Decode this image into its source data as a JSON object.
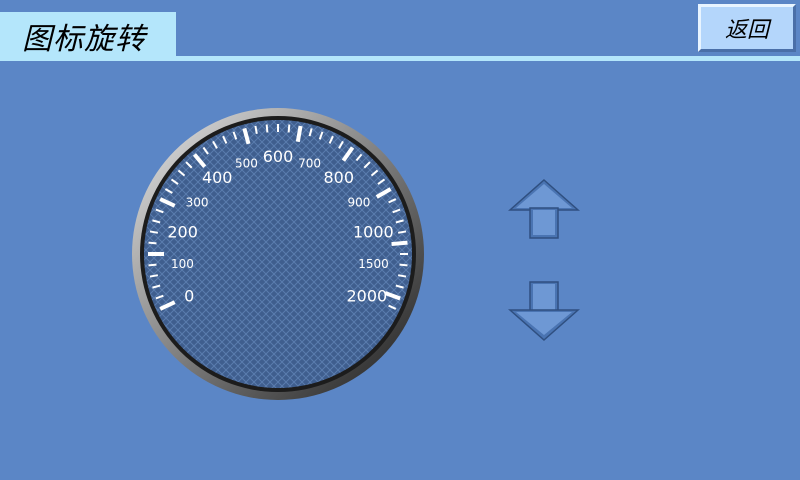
{
  "header": {
    "title": "图标旋转"
  },
  "toolbar": {
    "back_label": "返回"
  },
  "gauge": {
    "labels": [
      {
        "text": "0",
        "value": 0
      },
      {
        "text": "100",
        "value": 100
      },
      {
        "text": "200",
        "value": 200
      },
      {
        "text": "300",
        "value": 300
      },
      {
        "text": "400",
        "value": 400
      },
      {
        "text": "500",
        "value": 500
      },
      {
        "text": "600",
        "value": 600
      },
      {
        "text": "700",
        "value": 700
      },
      {
        "text": "800",
        "value": 800
      },
      {
        "text": "900",
        "value": 900
      },
      {
        "text": "1000",
        "value": 1000
      },
      {
        "text": "1500",
        "value": 1500
      },
      {
        "text": "2000",
        "value": 2000
      }
    ]
  },
  "controls": {
    "up_icon": "arrow-up-icon",
    "down_icon": "arrow-down-icon"
  },
  "colors": {
    "background": "#5b86c6",
    "title_bg": "#b4e6fb",
    "button_bg": "#b4d6fb",
    "gauge_face": "#3f5e8e"
  }
}
